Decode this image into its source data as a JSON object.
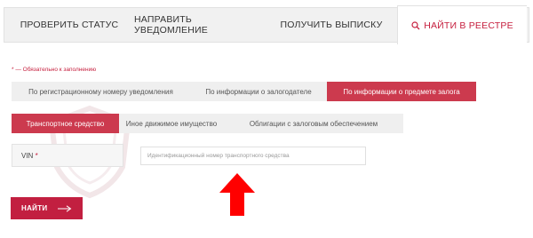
{
  "top_tabs": {
    "check_status": "ПРОВЕРИТЬ СТАТУС",
    "send_notice": "НАПРАВИТЬ УВЕДОМЛЕНИЕ",
    "get_extract": "ПОЛУЧИТЬ ВЫПИСКУ",
    "find_registry": "НАЙТИ В РЕЕСТРЕ",
    "active": "find_registry"
  },
  "required_note": "* — Обязательно к заполнению",
  "search_by": {
    "options": [
      "По регистрационному номеру уведомления",
      "По информации о залогодателе",
      "По информации о предмете залога"
    ],
    "active_index": 2
  },
  "property_type": {
    "options": [
      "Транспортное средство",
      "Иное движимое имущество",
      "Облигации с залоговым обеспечением"
    ],
    "active_index": 0
  },
  "vin": {
    "label": "VIN",
    "required_mark": "*",
    "value": "",
    "placeholder": "Идентификационный номер транспортного средства"
  },
  "submit_label": "НАЙТИ",
  "colors": {
    "accent": "#c6203f",
    "active_tab_bg": "#cc3a4e",
    "button_bg": "#c21f40",
    "arrow": "#ff0000"
  },
  "icons": {
    "search": "search-icon",
    "submit_arrow": "arrow-right-icon",
    "pointer": "red-up-arrow-icon"
  }
}
